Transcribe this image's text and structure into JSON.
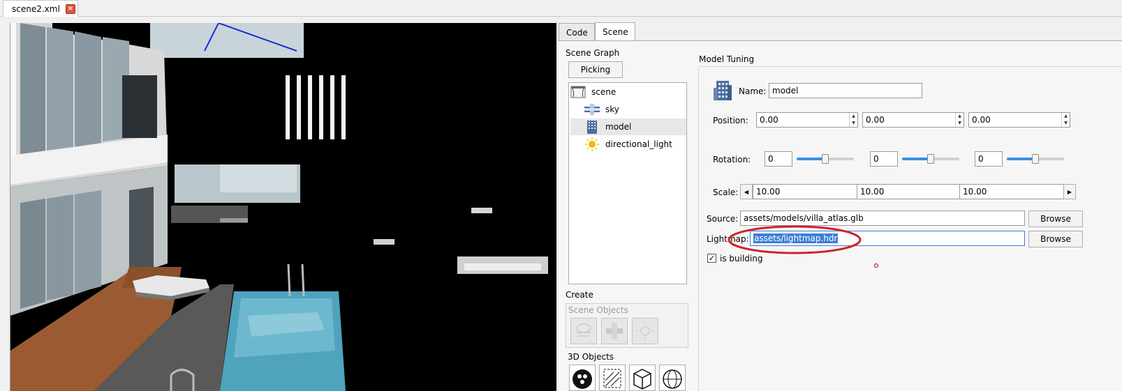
{
  "document_tab": {
    "title": "scene2.xml",
    "close_glyph": "×"
  },
  "panel_tabs": [
    "Code",
    "Scene"
  ],
  "scene_graph": {
    "heading": "Scene Graph",
    "picking_label": "Picking",
    "items": [
      {
        "label": "scene",
        "icon": "curtain-icon"
      },
      {
        "label": "sky",
        "icon": "sky-icon"
      },
      {
        "label": "model",
        "icon": "building-icon"
      },
      {
        "label": "directional_light",
        "icon": "sun-icon"
      }
    ]
  },
  "create": {
    "heading": "Create",
    "scene_objects_heading": "Scene Objects",
    "objects_3d_heading": "3D Objects"
  },
  "model_tuning": {
    "heading": "Model Tuning",
    "name_label": "Name:",
    "name_value": "model",
    "position_label": "Position:",
    "position": [
      "0.00",
      "0.00",
      "0.00"
    ],
    "rotation_label": "Rotation:",
    "rotation": [
      "0",
      "0",
      "0"
    ],
    "rotation_slider_levels": [
      0.5,
      0.5,
      0.5
    ],
    "scale_label": "Scale:",
    "scale": [
      "10.00",
      "10.00",
      "10.00"
    ],
    "source_label": "Source:",
    "source_value": "assets/models/villa_atlas.glb",
    "lightmap_label": "Lightmap:",
    "lightmap_value": "assets/lightmap.hdr",
    "browse_label": "Browse",
    "is_building_label": "is building",
    "is_building_checked": true,
    "check_glyph": "✓"
  },
  "colors": {
    "accent": "#3a8ee6",
    "annotation": "#d0202a",
    "selection": "#3c7fd7"
  }
}
